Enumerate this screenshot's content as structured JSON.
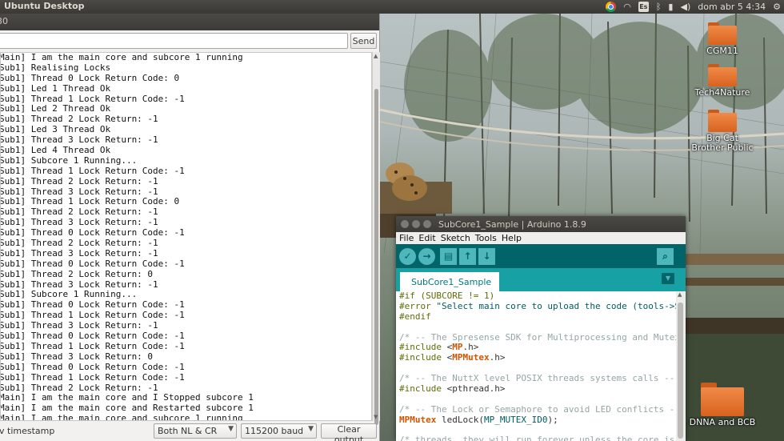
{
  "top_panel": {
    "title": "Ubuntu Desktop",
    "keyboard_layout": "Es",
    "clock": "dom abr 5  4:34",
    "tray_icons": [
      "chrome-icon",
      "wifi-icon",
      "keyboard-layout-icon",
      "bluetooth-icon",
      "battery-icon",
      "volume-icon",
      "settings-gear-icon"
    ]
  },
  "serial_monitor": {
    "title": "30",
    "input_value": "",
    "send_label": "Send",
    "lines": [
      "Main] I am the main core and subcore 1 running",
      "Sub1] Realising Locks",
      "Sub1] Thread 0 Lock Return Code: 0",
      "Sub1] Led 1 Thread Ok",
      "Sub1] Thread 1 Lock Return Code: -1",
      "Sub1] Led 2 Thread Ok",
      "Sub1] Thread 2 Lock Return: -1",
      "Sub1] Led 3 Thread Ok",
      "Sub1] Thread 3 Lock Return: -1",
      "Sub1] Led 4 Thread Ok",
      "Sub1] Subcore 1 Running...",
      "Sub1] Thread 1 Lock Return Code: -1",
      "Sub1] Thread 2 Lock Return: -1",
      "Sub1] Thread 3 Lock Return: -1",
      "Sub1] Thread 1 Lock Return Code: 0",
      "Sub1] Thread 2 Lock Return: -1",
      "Sub1] Thread 3 Lock Return: -1",
      "Sub1] Thread 0 Lock Return Code: -1",
      "Sub1] Thread 2 Lock Return: -1",
      "Sub1] Thread 3 Lock Return: -1",
      "Sub1] Thread 0 Lock Return Code: -1",
      "Sub1] Thread 2 Lock Return: 0",
      "Sub1] Thread 3 Lock Return: -1",
      "Sub1] Subcore 1 Running...",
      "Sub1] Thread 0 Lock Return Code: -1",
      "Sub1] Thread 1 Lock Return Code: -1",
      "Sub1] Thread 3 Lock Return: -1",
      "Sub1] Thread 0 Lock Return Code: -1",
      "Sub1] Thread 1 Lock Return Code: -1",
      "Sub1] Thread 3 Lock Return: 0",
      "Sub1] Thread 0 Lock Return Code: -1",
      "Sub1] Thread 1 Lock Return Code: -1",
      "Sub1] Thread 2 Lock Return: -1",
      "Main] I am the main core and I Stopped subcore 1",
      "Main] I am the main core and Restarted subcore 1",
      "Main] I am the main core and subcore 1 running"
    ],
    "autoscroll_label": "v timestamp",
    "line_ending": "Both NL & CR",
    "baud": "115200 baud",
    "clear_label": "Clear output"
  },
  "desktop_icons": [
    {
      "label": "CGM11"
    },
    {
      "label": "Tech4Nature"
    },
    {
      "label": "Big Cat Brother Public"
    },
    {
      "label": "DNNA and BCB"
    }
  ],
  "arduino_ide": {
    "title": "SubCore1_Sample | Arduino 1.8.9",
    "menu": [
      "File",
      "Edit",
      "Sketch",
      "Tools",
      "Help"
    ],
    "toolbar": {
      "verify": "verify-icon",
      "upload": "upload-arrow-icon",
      "new": "new-file-icon",
      "open": "open-arrow-up-icon",
      "save": "save-arrow-down-icon",
      "serial_monitor": "magnifier-icon"
    },
    "tab_name": "SubCore1_Sample",
    "code_lines": [
      [
        {
          "t": "pre",
          "s": "#if (SUBCORE != 1)"
        }
      ],
      [
        {
          "t": "pre",
          "s": "#error "
        },
        {
          "t": "str",
          "s": "\"Select main core to upload the code (tools->Su"
        }
      ],
      [
        {
          "t": "pre",
          "s": "#endif"
        }
      ],
      [],
      [
        {
          "t": "cmt",
          "s": "/* -- The Spresense SDK for Multiprocessing and Mutex"
        }
      ],
      [
        {
          "t": "pre",
          "s": "#include "
        },
        {
          "t": "plain",
          "s": "<"
        },
        {
          "t": "kw",
          "s": "MP"
        },
        {
          "t": "plain",
          "s": ".h>"
        }
      ],
      [
        {
          "t": "pre",
          "s": "#include "
        },
        {
          "t": "plain",
          "s": "<"
        },
        {
          "t": "kw",
          "s": "MPMutex"
        },
        {
          "t": "plain",
          "s": ".h>"
        }
      ],
      [],
      [
        {
          "t": "cmt",
          "s": "/* -- The NuttX level POSIX threads systems calls -- "
        }
      ],
      [
        {
          "t": "pre",
          "s": "#include "
        },
        {
          "t": "plain",
          "s": "<pthread.h>"
        }
      ],
      [],
      [
        {
          "t": "cmt",
          "s": "/* -- The Lock or Semaphore to avoid LED conflicts --"
        }
      ],
      [
        {
          "t": "kw",
          "s": "MPMutex"
        },
        {
          "t": "plain",
          "s": " ledLock("
        },
        {
          "t": "str",
          "s": "MP_MUTEX_ID0"
        },
        {
          "t": "plain",
          "s": ");"
        }
      ],
      [],
      [
        {
          "t": "cmt",
          "s": "/* threads, they will run forever unless the core is"
        }
      ]
    ]
  }
}
